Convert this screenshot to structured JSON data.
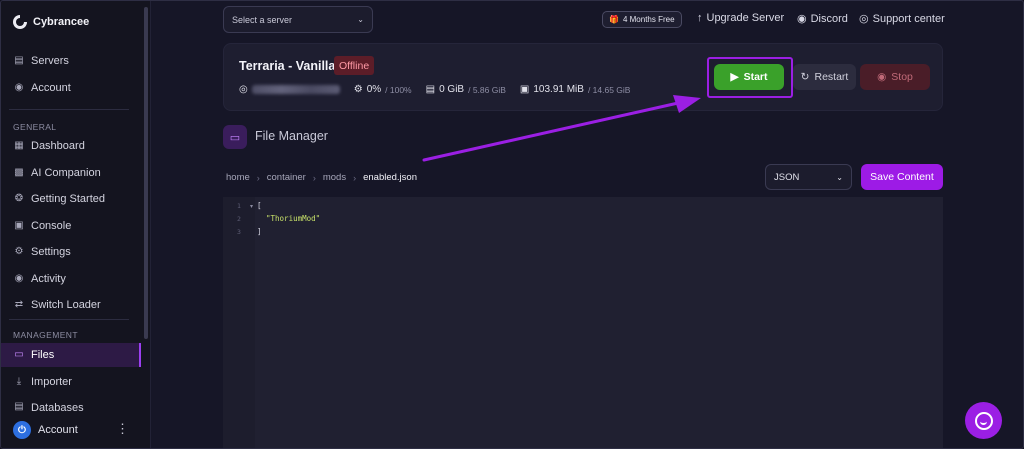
{
  "brand": {
    "name": "Cybrancee"
  },
  "sidebar": {
    "top_items": [
      {
        "label": "Servers",
        "icon": "server-icon"
      },
      {
        "label": "Account",
        "icon": "account-icon"
      }
    ],
    "general_label": "GENERAL",
    "general_items": [
      {
        "label": "Dashboard",
        "icon": "dashboard-icon"
      },
      {
        "label": "AI Companion",
        "icon": "robot-icon"
      },
      {
        "label": "Getting Started",
        "icon": "compass-icon"
      },
      {
        "label": "Console",
        "icon": "terminal-icon"
      },
      {
        "label": "Settings",
        "icon": "gear-icon"
      },
      {
        "label": "Activity",
        "icon": "eye-icon"
      },
      {
        "label": "Switch Loader",
        "icon": "swap-icon"
      }
    ],
    "management_label": "MANAGEMENT",
    "management_items": [
      {
        "label": "Files",
        "icon": "folder-icon",
        "active": true
      },
      {
        "label": "Importer",
        "icon": "download-icon"
      },
      {
        "label": "Databases",
        "icon": "database-icon"
      }
    ],
    "account_label": "Account"
  },
  "topbar": {
    "server_select_placeholder": "Select a server",
    "promo_label": "4 Months Free",
    "upgrade_label": "Upgrade Server",
    "discord_label": "Discord",
    "support_label": "Support center"
  },
  "server": {
    "name": "Terraria - Vanilla",
    "status": "Offline",
    "cpu": "0%",
    "cpu_limit": "/ 100%",
    "memory": "0 GiB",
    "memory_limit": "/ 5.86 GiB",
    "disk": "103.91 MiB",
    "disk_limit": "/ 14.65 GiB",
    "start_label": "Start",
    "restart_label": "Restart",
    "stop_label": "Stop"
  },
  "file_manager": {
    "title": "File Manager",
    "breadcrumb": [
      "home",
      "container",
      "mods",
      "enabled.json"
    ],
    "language": "JSON",
    "save_label": "Save Content",
    "lines": [
      {
        "num": "1",
        "text": "["
      },
      {
        "num": "2",
        "text": "\"ThoriumMod\""
      },
      {
        "num": "3",
        "text": "]"
      }
    ]
  },
  "colors": {
    "accent": "#9d1be6",
    "start_green": "#3aa12a",
    "offline_bg": "#5c1d28",
    "annotation_arrow": "#9b1fe4"
  }
}
